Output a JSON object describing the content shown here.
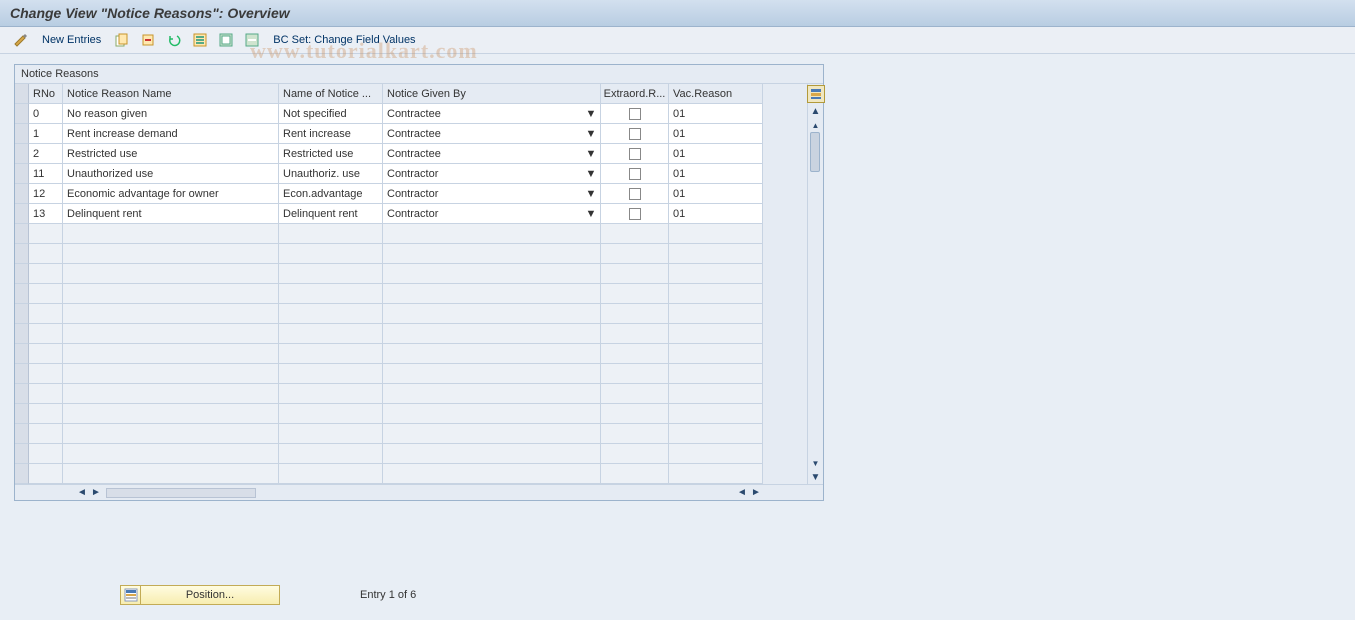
{
  "title": "Change View \"Notice Reasons\": Overview",
  "toolbar": {
    "new_entries": "New Entries",
    "bc_set": "BC Set: Change Field Values"
  },
  "table": {
    "box_title": "Notice Reasons",
    "headers": {
      "rno": "RNo",
      "name": "Notice Reason Name",
      "notname": "Name of Notice ...",
      "given": "Notice Given By",
      "extra": "Extraord.R...",
      "vac": "Vac.Reason"
    },
    "rows": [
      {
        "rno": "0",
        "name": "No reason given",
        "notname": "Not specified",
        "given": "Contractee",
        "extra": false,
        "vac": "01"
      },
      {
        "rno": "1",
        "name": "Rent increase demand",
        "notname": "Rent increase",
        "given": "Contractee",
        "extra": false,
        "vac": "01"
      },
      {
        "rno": "2",
        "name": "Restricted use",
        "notname": "Restricted use",
        "given": "Contractee",
        "extra": false,
        "vac": "01"
      },
      {
        "rno": "11",
        "name": "Unauthorized use",
        "notname": "Unauthoriz. use",
        "given": "Contractor",
        "extra": false,
        "vac": "01"
      },
      {
        "rno": "12",
        "name": "Economic advantage for owner",
        "notname": "Econ.advantage",
        "given": "Contractor",
        "extra": false,
        "vac": "01"
      },
      {
        "rno": "13",
        "name": "Delinquent rent",
        "notname": "Delinquent rent",
        "given": "Contractor",
        "extra": false,
        "vac": "01"
      }
    ],
    "empty_rows": 13
  },
  "footer": {
    "position": "Position...",
    "entry": "Entry 1 of 6"
  },
  "watermark": "www.tutorialkart.com"
}
